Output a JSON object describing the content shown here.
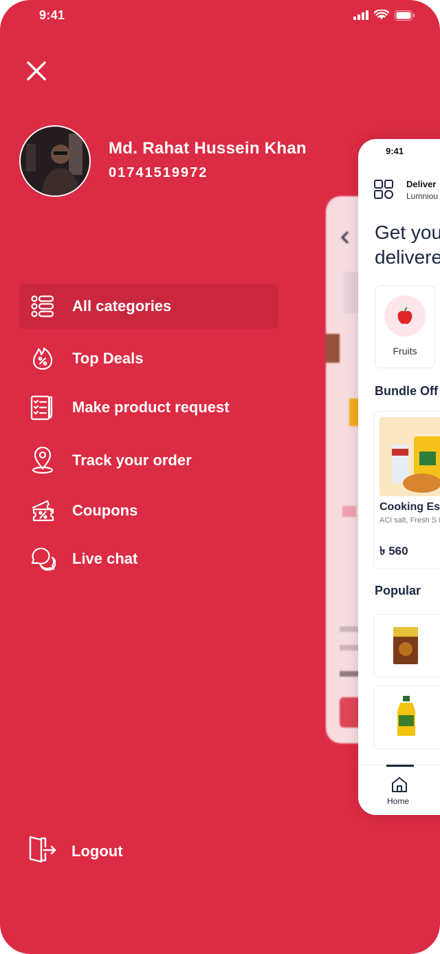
{
  "status_bar": {
    "time": "9:41"
  },
  "profile": {
    "name": "Md. Rahat Hussein Khan",
    "phone": "01741519972"
  },
  "menu": {
    "items": [
      {
        "label": "All categories",
        "icon": "categories-list-icon",
        "active": true
      },
      {
        "label": "Top Deals",
        "icon": "discount-flame-icon",
        "active": false
      },
      {
        "label": "Make product request",
        "icon": "request-form-icon",
        "active": false
      },
      {
        "label": "Track your order",
        "icon": "location-pin-icon",
        "active": false
      },
      {
        "label": "Coupons",
        "icon": "coupon-ticket-icon",
        "active": false
      },
      {
        "label": "Live chat",
        "icon": "chat-bubbles-icon",
        "active": false
      }
    ],
    "logout_label": "Logout"
  },
  "preview": {
    "time": "9:41",
    "deliver_label": "Deliver",
    "location": "Lumniou",
    "headline_1": "Get you",
    "headline_2": "delivere",
    "category": "Fruits",
    "bundle_heading": "Bundle Off",
    "product": {
      "name": "Cooking Es",
      "desc": "ACI salt, Fresh S Dal, Rice",
      "price": "৳ 560"
    },
    "popular_heading": "Popular",
    "nav_home": "Home"
  },
  "colors": {
    "drawer_bg": "#dc2b44",
    "text_dark": "#1d2742"
  }
}
